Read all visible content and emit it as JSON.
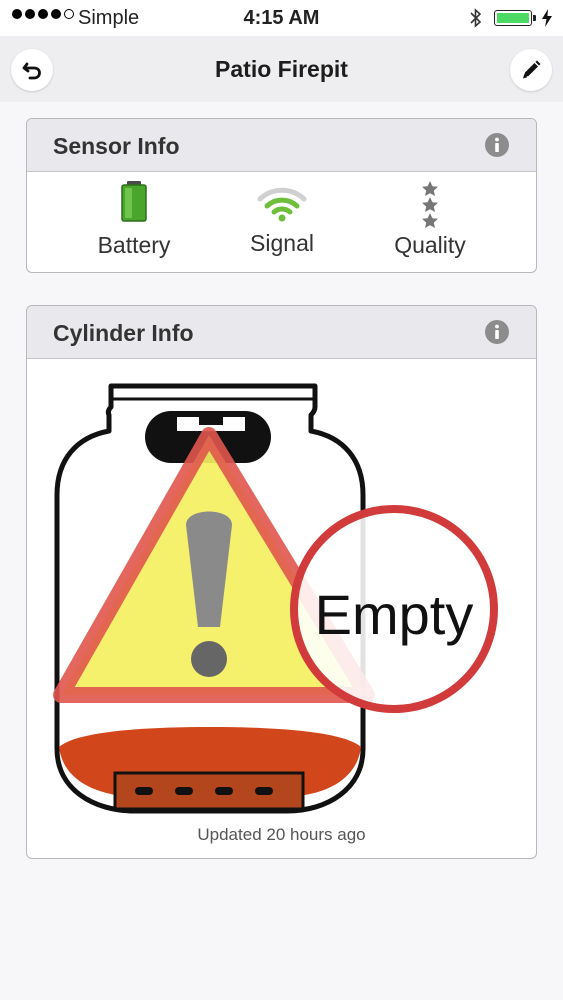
{
  "status_bar": {
    "carrier": "Simple",
    "time": "4:15 AM",
    "signal_bars_filled": 4,
    "signal_bars_total": 5,
    "battery_color": "#4cd964"
  },
  "nav": {
    "title": "Patio Firepit",
    "back_icon": "undo-arrow-icon",
    "edit_icon": "pencil-icon"
  },
  "sensor_info": {
    "title": "Sensor Info",
    "info_icon": "info-icon",
    "items": [
      {
        "label": "Battery",
        "icon": "battery-icon"
      },
      {
        "label": "Signal",
        "icon": "wifi-signal-icon"
      },
      {
        "label": "Quality",
        "icon": "stars-icon"
      }
    ],
    "colors": {
      "battery": "#4aa52c",
      "signal": "#6fbf3c",
      "stars": "#777777"
    }
  },
  "cylinder_info": {
    "title": "Cylinder Info",
    "info_icon": "info-icon",
    "status": "Empty",
    "updated": "Updated 20 hours ago",
    "colors": {
      "warning_fill": "#f5f060",
      "warning_border": "#e0574e",
      "liquid": "#d2461c",
      "ring": "#d23b3b"
    }
  }
}
